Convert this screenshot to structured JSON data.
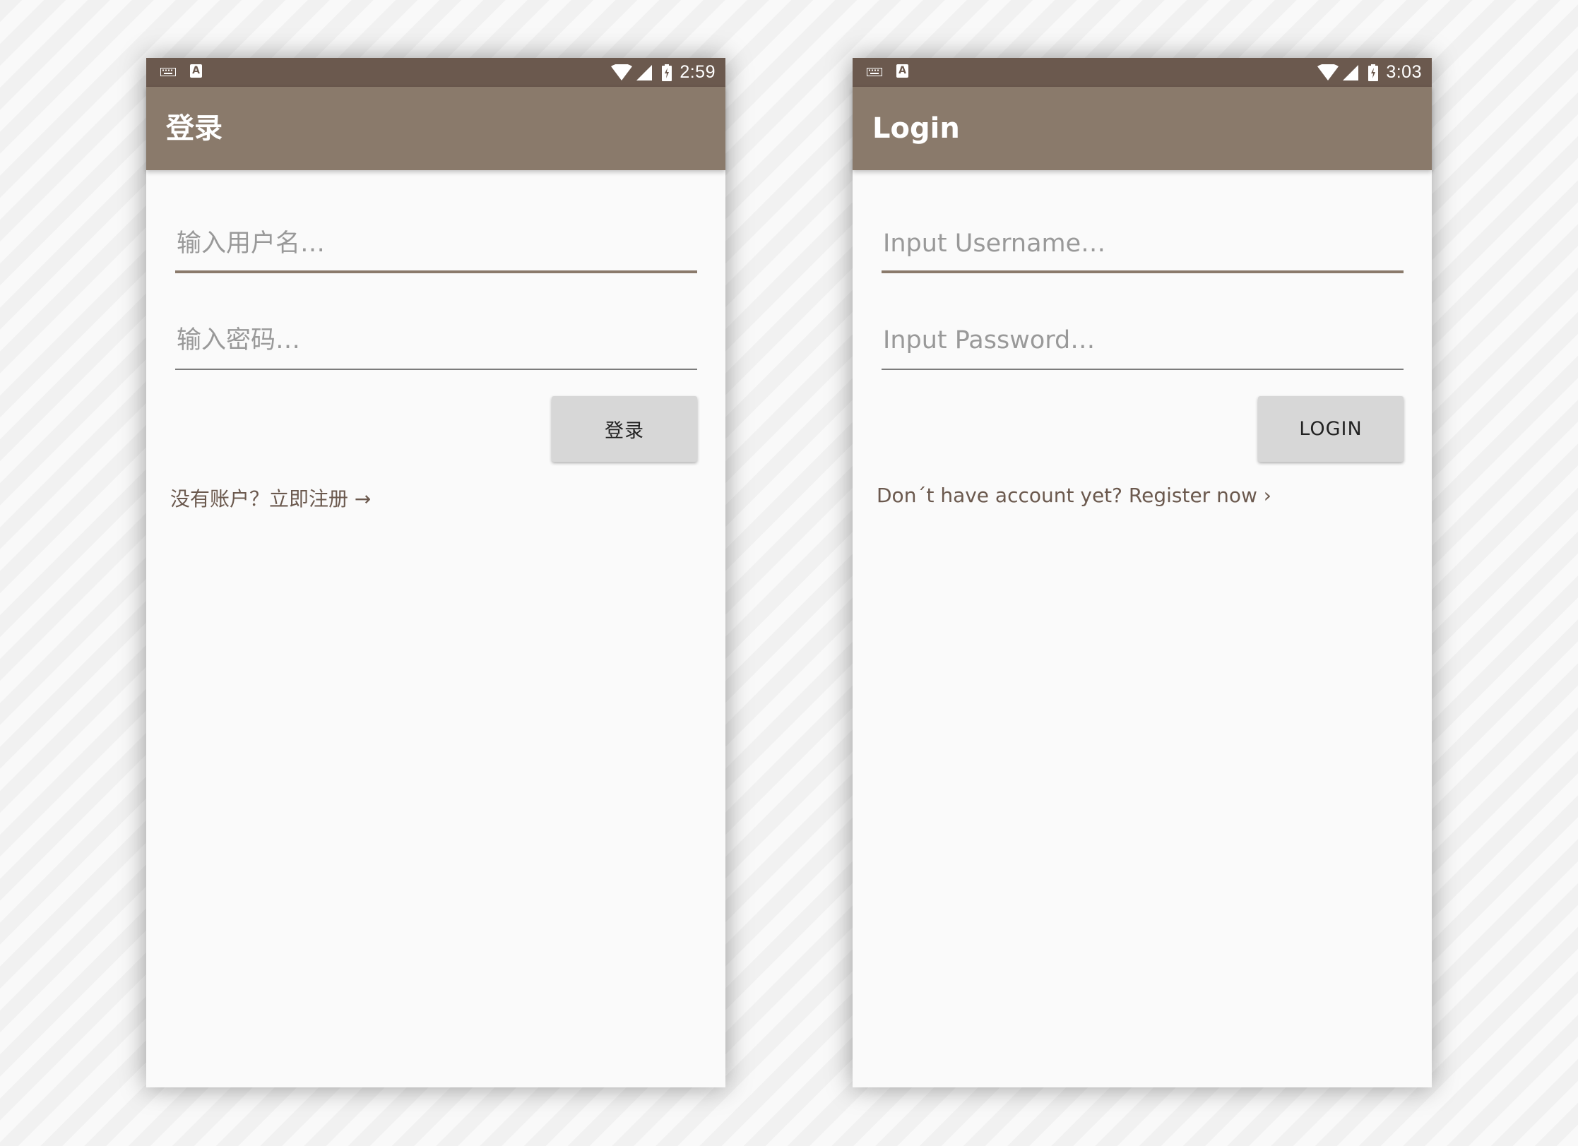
{
  "colors": {
    "status_bar": "#6b594e",
    "app_bar": "#8a7a6b",
    "accent": "#8a7a6b",
    "background": "#fafafa",
    "button": "#d7d7d7",
    "link": "#6b594e"
  },
  "icons": {
    "status_left": [
      "keyboard-icon",
      "a-icon"
    ],
    "status_right": [
      "wifi-icon",
      "signal-icon",
      "battery-icon"
    ]
  },
  "phones": [
    {
      "language": "zh",
      "status_bar": {
        "time": "2:59",
        "a_glyph": "A"
      },
      "app_bar": {
        "title": "登录"
      },
      "username": {
        "placeholder": "输入用户名…",
        "value": "",
        "focused": true
      },
      "password": {
        "placeholder": "输入密码…",
        "value": ""
      },
      "login_button": {
        "label": "登录"
      },
      "register_link": {
        "label": "没有账户？立即注册 →"
      }
    },
    {
      "language": "en",
      "status_bar": {
        "time": "3:03",
        "a_glyph": "A"
      },
      "app_bar": {
        "title": "Login"
      },
      "username": {
        "placeholder": "Input Username…",
        "value": "",
        "focused": true
      },
      "password": {
        "placeholder": "Input Password…",
        "value": ""
      },
      "login_button": {
        "label": "LOGIN"
      },
      "register_link": {
        "label": "Don´t have account yet? Register now ›"
      }
    }
  ]
}
